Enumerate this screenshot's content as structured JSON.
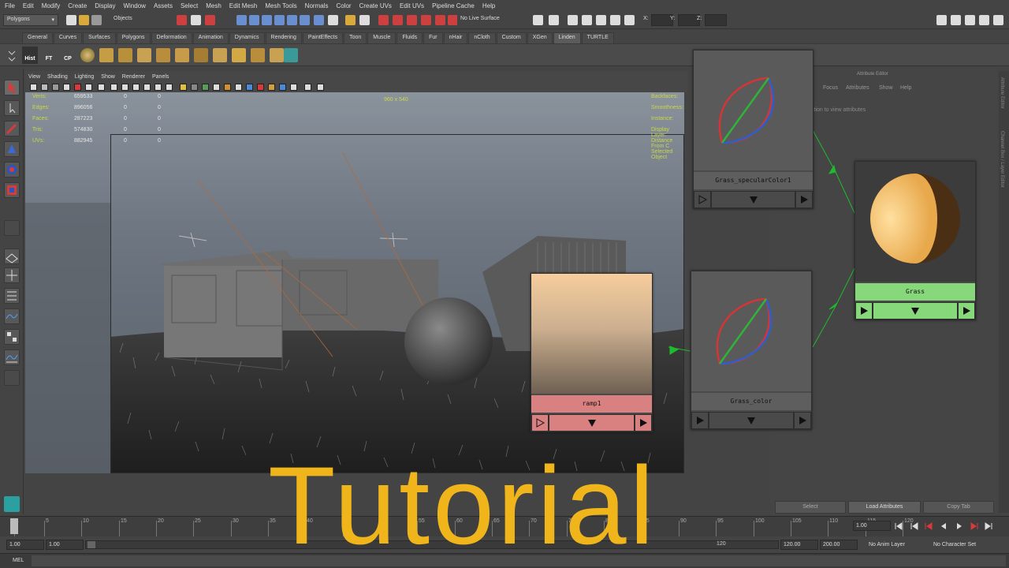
{
  "menubar": {
    "items": [
      "File",
      "Edit",
      "Modify",
      "Create",
      "Display",
      "Window",
      "Assets",
      "Select",
      "Mesh",
      "Edit Mesh",
      "Mesh Tools",
      "Normals",
      "Color",
      "Create UVs",
      "Edit UVs",
      "Pipeline Cache",
      "Help"
    ]
  },
  "statusline": {
    "mode": "Polygons",
    "selection": "Objects",
    "live_surface": "No Live Surface",
    "x_label": "X:",
    "y_label": "Y:",
    "z_label": "Z:"
  },
  "shelf": {
    "tabs": [
      "General",
      "Curves",
      "Surfaces",
      "Polygons",
      "Deformation",
      "Animation",
      "Dynamics",
      "Rendering",
      "PaintEffects",
      "Toon",
      "Muscle",
      "Fluids",
      "Fur",
      "nHair",
      "nCloth",
      "Custom",
      "XGen",
      "Linden",
      "TURTLE"
    ],
    "active_tab": "Linden",
    "buttons": [
      "Hist",
      "FT",
      "CP"
    ]
  },
  "panel": {
    "menus": [
      "View",
      "Shading",
      "Lighting",
      "Show",
      "Renderer",
      "Panels"
    ]
  },
  "hud": {
    "left_labels": [
      "Verts:",
      "Edges:",
      "Faces:",
      "Tris:",
      "UVs:"
    ],
    "values": [
      "659533",
      "896056",
      "287223",
      "574830",
      "882945"
    ],
    "zeros_a": [
      "0",
      "0",
      "0",
      "0",
      "0"
    ],
    "zeros_b": [
      "0",
      "0",
      "0",
      "0",
      "0"
    ],
    "right_labels": [
      "Backfaces:",
      "Smoothness:",
      "Instance:",
      "Display Layer:",
      "Distance From C",
      "Selected Object"
    ],
    "resolution": "960 x 540"
  },
  "nodes": {
    "specular": "Grass_specularColor1",
    "ramp": "ramp1",
    "color": "Grass_color",
    "material": "Grass"
  },
  "attribute_editor": {
    "title": "Attribute Editor",
    "menus": [
      "Focus",
      "Attributes",
      "Show",
      "Help"
    ],
    "hint": "ction to view attributes",
    "buttons": [
      "Select",
      "Load Attributes",
      "Copy Tab"
    ],
    "side_tabs": [
      "Attribute Editor",
      "Channel Box / Layer Editor"
    ]
  },
  "timeline": {
    "ticks": [
      "1",
      "5",
      "10",
      "15",
      "20",
      "25",
      "30",
      "35",
      "40",
      "45",
      "50",
      "55",
      "60",
      "65",
      "70",
      "75",
      "80",
      "85",
      "90",
      "95",
      "100",
      "105",
      "110",
      "115",
      "120"
    ],
    "current_frame": "1.00",
    "range_start": "1.00",
    "range_inner_start": "1.00",
    "range_inner_end": "120",
    "range_end_a": "120.00",
    "range_end_b": "200.00",
    "anim_layer": "No Anim Layer",
    "character_set": "No Character Set"
  },
  "commandline": {
    "label": "MEL"
  },
  "overlay": {
    "title": "Tutorial"
  },
  "colors": {
    "title_yellow": "#f1b51c",
    "hud_yellow": "#c9d74a",
    "ramp_label_bg": "#d98080",
    "material_label_bg": "#86d87a",
    "connection_green": "#1dbb2d"
  }
}
